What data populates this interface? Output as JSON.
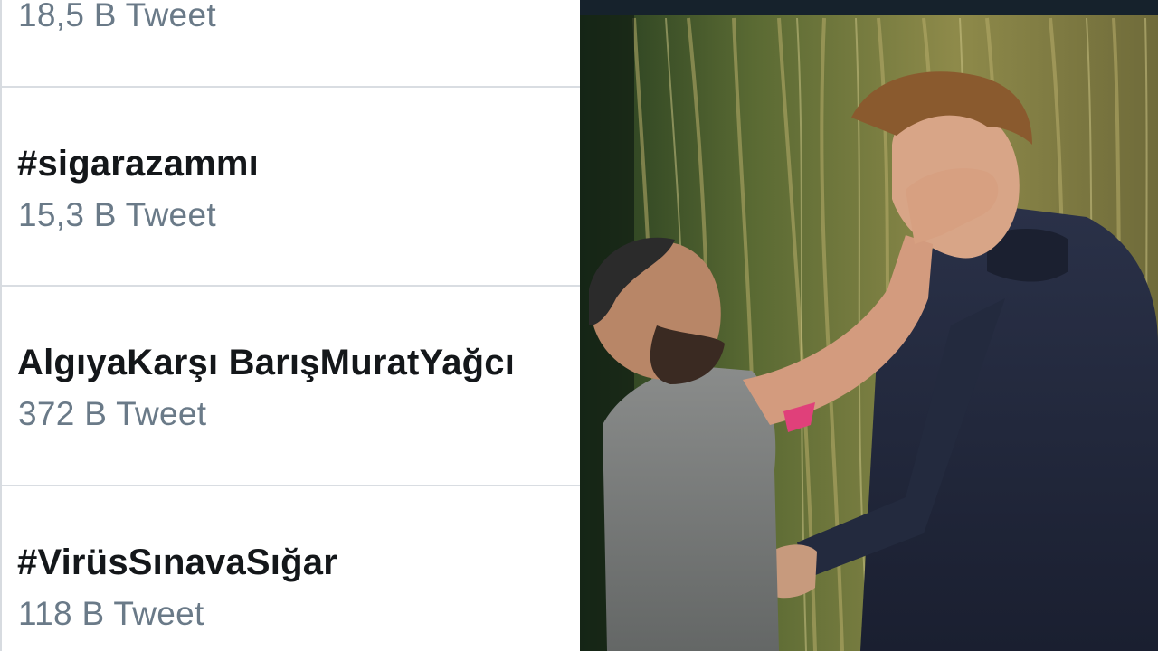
{
  "trends": [
    {
      "name": "",
      "count": "18,5 B Tweet"
    },
    {
      "name": "#sigarazammı",
      "count": "15,3 B Tweet"
    },
    {
      "name": "AlgıyaKarşı BarışMuratYağcı",
      "count": "372 B Tweet"
    },
    {
      "name": "#VirüsSınavaSığar",
      "count": "118 B Tweet"
    }
  ],
  "photo": {
    "description_icon": "photo-image"
  }
}
